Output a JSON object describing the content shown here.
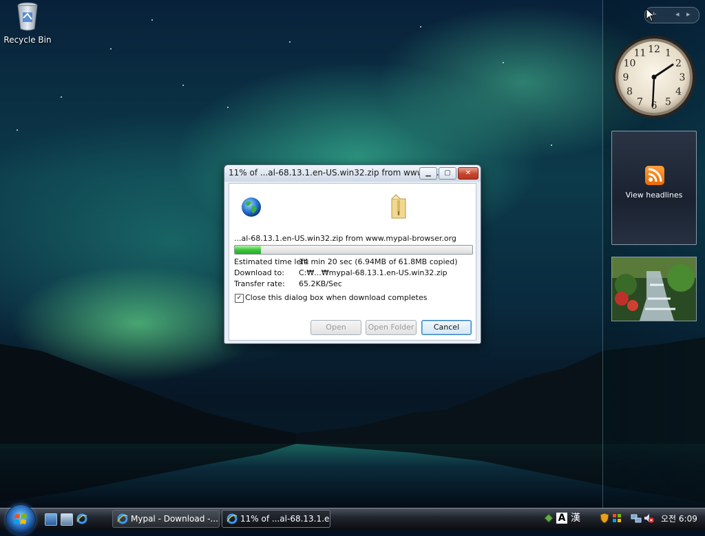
{
  "desktop": {
    "recycle_bin_label": "Recycle Bin"
  },
  "sidebar": {
    "feed_label": "View headlines",
    "clock_numbers": [
      "12",
      "1",
      "2",
      "3",
      "4",
      "5",
      "6",
      "7",
      "8",
      "9",
      "10",
      "11"
    ]
  },
  "dialog": {
    "title": "11% of ...al-68.13.1.en-US.win32.zip from www.m...",
    "source": "...al-68.13.1.en-US.win32.zip from www.mypal-browser.org",
    "progress_percent": 11,
    "estimated_label": "Estimated time left:",
    "estimated_value": "14 min 20 sec (6.94MB of 61.8MB copied)",
    "download_to_label": "Download to:",
    "download_to_value": "C:₩...₩mypal-68.13.1.en-US.win32.zip",
    "transfer_rate_label": "Transfer rate:",
    "transfer_rate_value": "65.2KB/Sec",
    "close_checkbox_label": "Close this dialog box when download completes",
    "close_checkbox_checked": true,
    "open_label": "Open",
    "open_folder_label": "Open Folder",
    "cancel_label": "Cancel"
  },
  "taskbar": {
    "tasks": [
      {
        "label": "Mypal - Download -..."
      },
      {
        "label": "11% of ...al-68.13.1.e..."
      }
    ],
    "ime_letter": "A",
    "ime_hanja": "漢",
    "clock": "오전 6:09"
  },
  "colors": {
    "progress_green": "#3cc83c",
    "rss_orange": "#f08010",
    "cancel_focus": "#3c7fb1"
  }
}
